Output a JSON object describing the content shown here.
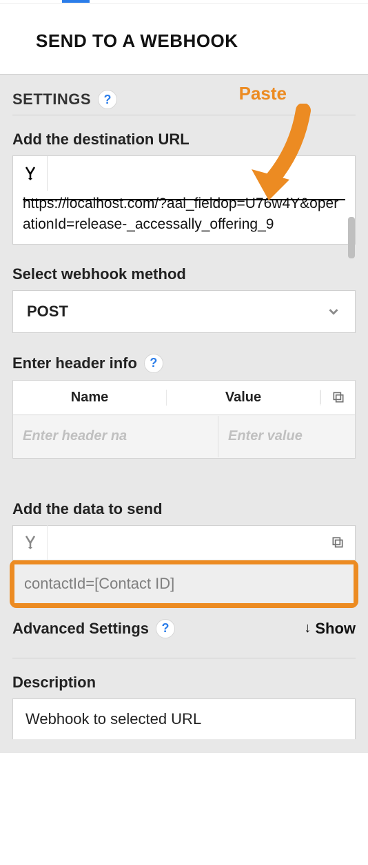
{
  "page_title": "SEND TO A WEBHOOK",
  "annotation": {
    "paste_label": "Paste"
  },
  "settings": {
    "label": "SETTINGS",
    "destination_url": {
      "label": "Add the destination URL",
      "value_display": "https://localhost.com/?aal_fieldop=U76w4Y&operationId=release-_accessally_offering_9"
    },
    "method": {
      "label": "Select webhook method",
      "value": "POST"
    },
    "header_info": {
      "label": "Enter header info",
      "col_name": "Name",
      "col_value": "Value",
      "name_placeholder": "Enter header na",
      "value_placeholder": "Enter value"
    },
    "data_to_send": {
      "label": "Add the data to send",
      "value": "contactId=[Contact ID]"
    },
    "advanced": {
      "label": "Advanced Settings",
      "toggle_label": "Show"
    },
    "description": {
      "label": "Description",
      "value": "Webhook to selected URL"
    }
  }
}
